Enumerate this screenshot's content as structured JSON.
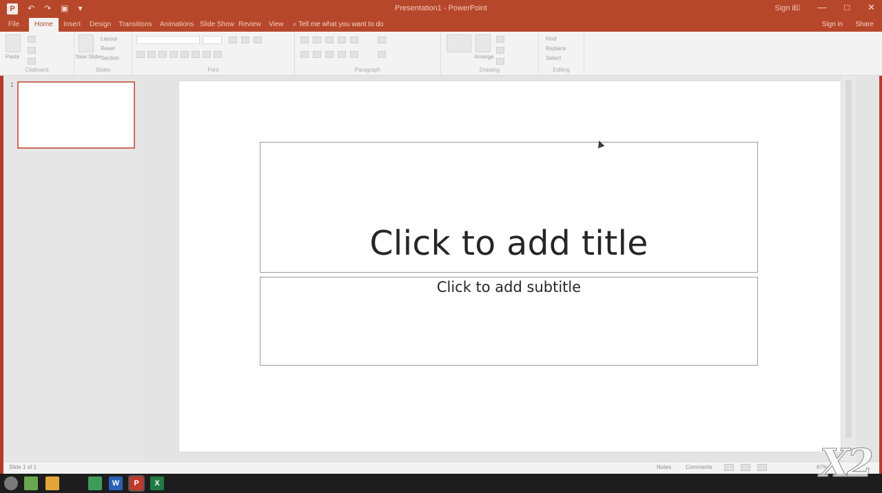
{
  "titlebar": {
    "app_logo": "P",
    "qat": [
      "↶",
      "↷",
      "▣",
      "▾"
    ],
    "doc_title": "Presentation1 - PowerPoint",
    "user": "Sign in",
    "window_buttons": [
      "□",
      "—",
      "□",
      "✕"
    ]
  },
  "ribbon_tabs": [
    "File",
    "Home",
    "Insert",
    "Design",
    "Transitions",
    "Animations",
    "Slide Show",
    "Review",
    "View"
  ],
  "tell_me": "⌕ Tell me what you want to do",
  "ribbon_right": [
    "Sign in",
    "Share"
  ],
  "ribbon_groups": [
    "Clipboard",
    "Slides",
    "Font",
    "Paragraph",
    "Drawing",
    "Editing"
  ],
  "ribbon_labels": {
    "paste": "Paste",
    "new_slide": "New Slide",
    "layout": "Layout",
    "reset": "Reset",
    "section": "Section",
    "arrange": "Arrange",
    "find": "Find",
    "replace": "Replace",
    "select": "Select"
  },
  "thumbnail": {
    "slide_number": "1"
  },
  "slide": {
    "title_placeholder": "Click to add title",
    "subtitle_placeholder": "Click to add subtitle"
  },
  "statusbar": {
    "left": "Slide 1 of 1",
    "notes": "Notes",
    "comments": "Comments",
    "zoom": "67%"
  },
  "taskbar": {
    "word": "W",
    "ppt": "P",
    "excel": "X"
  },
  "watermark": "X2",
  "colors": {
    "accent": "#b7472a",
    "taskbar": "#1d1d1d"
  }
}
